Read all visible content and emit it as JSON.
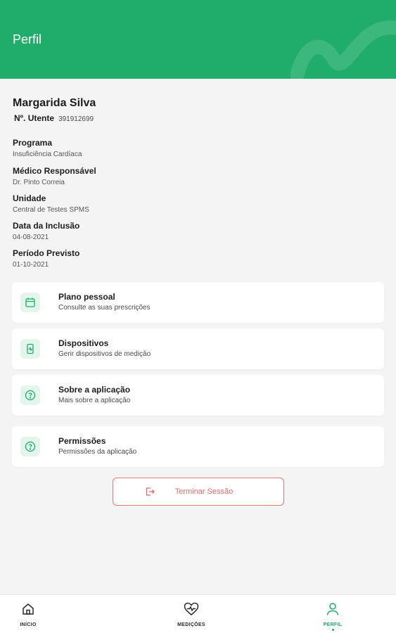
{
  "header": {
    "title": "Perfil"
  },
  "profile": {
    "name": "Margarida Silva",
    "utente_label": "Nº. Utente",
    "utente_value": "391912699"
  },
  "info": [
    {
      "label": "Programa",
      "value": "Insuficiência Cardíaca"
    },
    {
      "label": "Médico Responsável",
      "value": "Dr. Pinto Correia"
    },
    {
      "label": "Unidade",
      "value": "Central de Testes SPMS"
    },
    {
      "label": "Data da Inclusão",
      "value": "04-08-2021"
    },
    {
      "label": "Período Previsto",
      "value": "01-10-2021"
    }
  ],
  "cards": [
    {
      "title": "Plano pessoal",
      "subtitle": "Consulte as suas prescrições",
      "icon": "calendar-icon"
    },
    {
      "title": "Dispositivos",
      "subtitle": "Gerir dispositivos de medição",
      "icon": "device-icon"
    },
    {
      "title": "Sobre a aplicação",
      "subtitle": "Mais sobre a aplicação",
      "icon": "help-icon"
    },
    {
      "title": "Permissões",
      "subtitle": "Permissões da aplicação",
      "icon": "help-icon"
    }
  ],
  "logout": {
    "label": "Terminar Sessão",
    "icon": "logout-icon"
  },
  "nav": [
    {
      "label": "INÍCIO",
      "icon": "home-icon",
      "active": false
    },
    {
      "label": "MEDIÇÕES",
      "icon": "heart-pulse-icon",
      "active": false
    },
    {
      "label": "PERFIL",
      "icon": "user-icon",
      "active": true
    }
  ],
  "colors": {
    "primary": "#20ad6b",
    "icon_bg": "#e4f5ec",
    "danger": "#e06a6a",
    "background": "#f4f4f4"
  }
}
